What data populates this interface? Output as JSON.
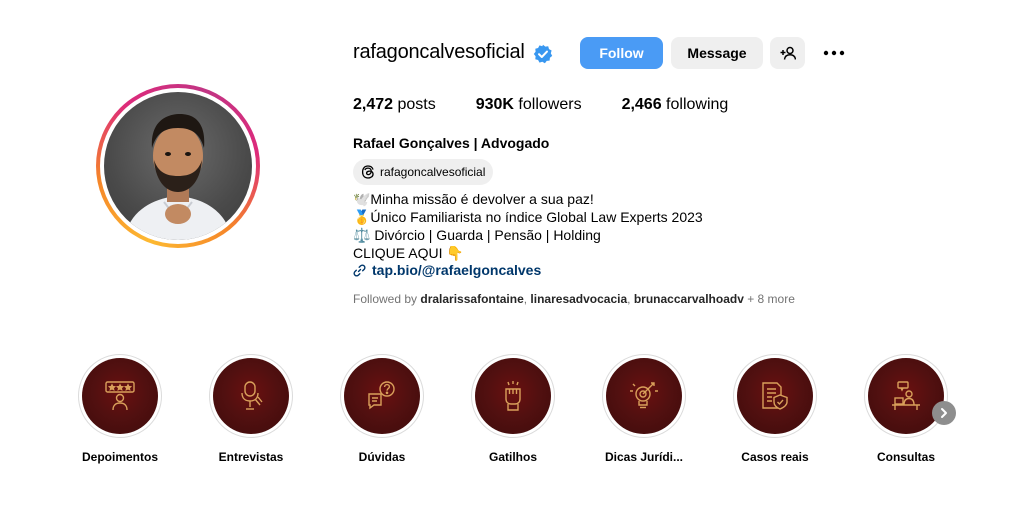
{
  "profile": {
    "username": "rafagoncalvesoficial",
    "follow_label": "Follow",
    "message_label": "Message",
    "stats": {
      "posts_count": "2,472",
      "posts_label": " posts",
      "followers_count": "930K",
      "followers_label": " followers",
      "following_count": "2,466",
      "following_label": " following"
    },
    "full_name": "Rafael Gonçalves | Advogado",
    "threads_handle": "rafagoncalvesoficial",
    "bio_lines": [
      "🕊️Minha missão é devolver a sua paz!",
      "🥇Único Familiarista no índice Global Law Experts 2023",
      "⚖️ Divórcio | Guarda | Pensão | Holding",
      "CLIQUE AQUI 👇"
    ],
    "bio_link": "tap.bio/@rafaelgoncalves",
    "followed_by": {
      "prefix": "Followed by ",
      "users": [
        "dralarissafontaine",
        "linaresadvocacia",
        "brunaccarvalhoadv"
      ],
      "more": " + 8 more"
    }
  },
  "highlights": [
    {
      "label": "Depoimentos",
      "icon": "reviews-icon"
    },
    {
      "label": "Entrevistas",
      "icon": "microphone-icon"
    },
    {
      "label": "Dúvidas",
      "icon": "question-chat-icon"
    },
    {
      "label": "Gatilhos",
      "icon": "fist-icon"
    },
    {
      "label": "Dicas Jurídi...",
      "icon": "idea-target-icon"
    },
    {
      "label": "Casos reais",
      "icon": "document-shield-icon"
    },
    {
      "label": "Consultas",
      "icon": "consultation-icon"
    }
  ],
  "colors": {
    "follow_button": "#4a9bf5",
    "verified_badge": "#3897f0",
    "link": "#00376b",
    "highlight_bg": "#521010",
    "highlight_icon": "#d9a05b"
  }
}
